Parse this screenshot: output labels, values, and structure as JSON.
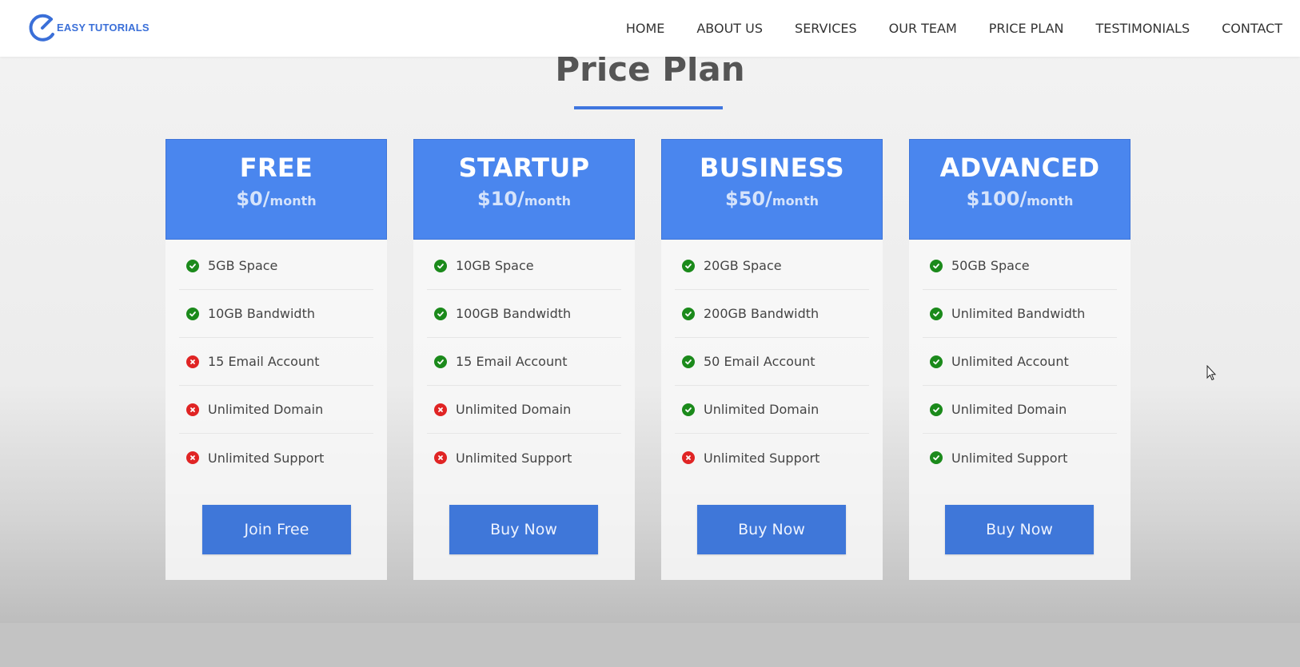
{
  "brand": {
    "logo_text": "EASY TUTORIALS",
    "accent": "#3f76df"
  },
  "nav": {
    "items": [
      "HOME",
      "ABOUT US",
      "SERVICES",
      "OUR TEAM",
      "PRICE PLAN",
      "TESTIMONIALS",
      "CONTACT"
    ]
  },
  "section": {
    "title": "Price Plan"
  },
  "colors": {
    "header_blue": "#4a86ee",
    "button_blue": "#3f77d9",
    "check_green": "#1b8a1b",
    "cross_red": "#e02424"
  },
  "plans": [
    {
      "name": "FREE",
      "price": "$0/",
      "unit": "month",
      "features": [
        {
          "label": "5GB Space",
          "included": true
        },
        {
          "label": "10GB Bandwidth",
          "included": true
        },
        {
          "label": "15 Email Account",
          "included": false
        },
        {
          "label": "Unlimited Domain",
          "included": false
        },
        {
          "label": "Unlimited Support",
          "included": false
        }
      ],
      "button": "Join Free"
    },
    {
      "name": "STARTUP",
      "price": "$10/",
      "unit": "month",
      "features": [
        {
          "label": "10GB Space",
          "included": true
        },
        {
          "label": "100GB Bandwidth",
          "included": true
        },
        {
          "label": "15 Email Account",
          "included": true
        },
        {
          "label": "Unlimited Domain",
          "included": false
        },
        {
          "label": "Unlimited Support",
          "included": false
        }
      ],
      "button": "Buy Now"
    },
    {
      "name": "BUSINESS",
      "price": "$50/",
      "unit": "month",
      "features": [
        {
          "label": "20GB Space",
          "included": true
        },
        {
          "label": "200GB Bandwidth",
          "included": true
        },
        {
          "label": "50 Email Account",
          "included": true
        },
        {
          "label": "Unlimited Domain",
          "included": true
        },
        {
          "label": "Unlimited Support",
          "included": false
        }
      ],
      "button": "Buy Now"
    },
    {
      "name": "ADVANCED",
      "price": "$100/",
      "unit": "month",
      "features": [
        {
          "label": "50GB Space",
          "included": true
        },
        {
          "label": "Unlimited Bandwidth",
          "included": true
        },
        {
          "label": "Unlimited Account",
          "included": true
        },
        {
          "label": "Unlimited Domain",
          "included": true
        },
        {
          "label": "Unlimited Support",
          "included": true
        }
      ],
      "button": "Buy Now"
    }
  ]
}
